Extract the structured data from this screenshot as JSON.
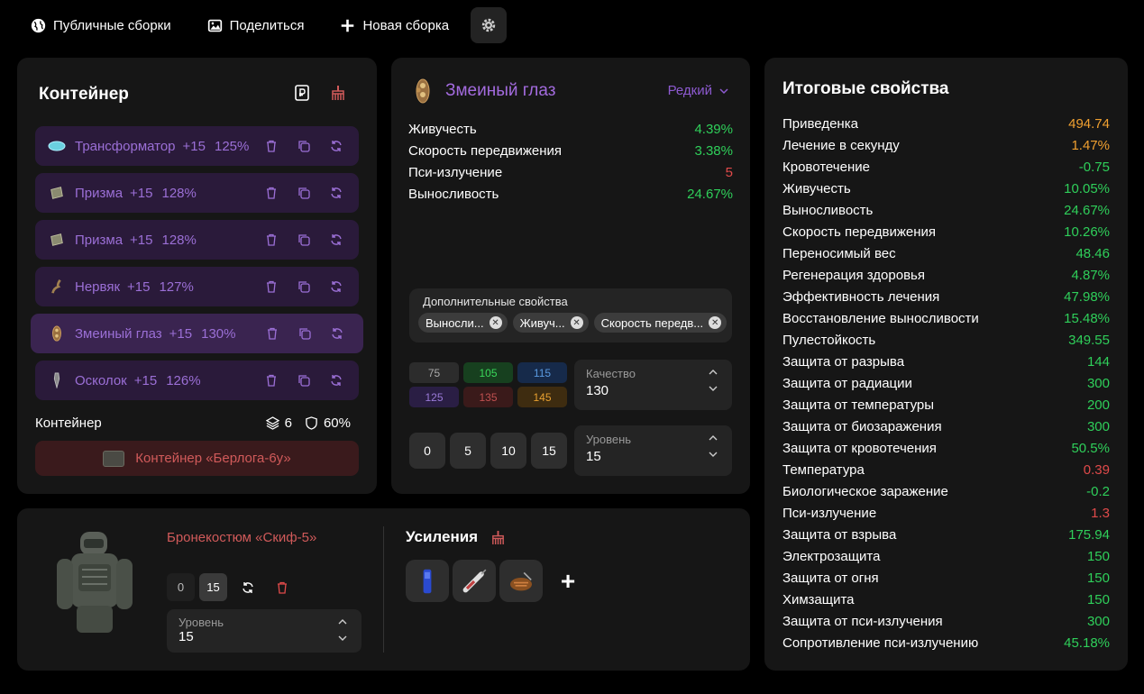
{
  "topbar": {
    "public_label": "Публичные сборки",
    "share_label": "Поделиться",
    "new_label": "Новая сборка"
  },
  "container": {
    "title": "Контейнер",
    "artifacts": [
      {
        "name": "Трансформатор",
        "level": "+15",
        "quality": "125%"
      },
      {
        "name": "Призма",
        "level": "+15",
        "quality": "128%"
      },
      {
        "name": "Призма",
        "level": "+15",
        "quality": "128%"
      },
      {
        "name": "Нервяк",
        "level": "+15",
        "quality": "127%"
      },
      {
        "name": "Змеиный глаз",
        "level": "+15",
        "quality": "130%"
      },
      {
        "name": "Осколок",
        "level": "+15",
        "quality": "126%"
      }
    ],
    "footer_label": "Контейнер",
    "slots": "6",
    "protection": "60%",
    "container_button": "Контейнер «Берлога-6у»"
  },
  "item": {
    "name": "Змеиный глаз",
    "rarity": "Редкий",
    "stats": [
      {
        "label": "Живучесть",
        "value": "4.39%"
      },
      {
        "label": "Скорость передвижения",
        "value": "3.38%"
      },
      {
        "label": "Пси-излучение",
        "value": "5"
      },
      {
        "label": "Выносливость",
        "value": "24.67%"
      }
    ],
    "extra_title": "Дополнительные свойства",
    "extra_chips": [
      "Выносли...",
      "Живуч...",
      "Скорость передв..."
    ],
    "quality_presets": [
      "75",
      "105",
      "115",
      "125",
      "135",
      "145"
    ],
    "quality_label": "Качество",
    "quality_value": "130",
    "level_presets": [
      "0",
      "5",
      "10",
      "15"
    ],
    "level_label": "Уровень",
    "level_value": "15"
  },
  "totals": {
    "title": "Итоговые свойства",
    "rows": [
      {
        "label": "Приведенка",
        "value": "494.74"
      },
      {
        "label": "Лечение в секунду",
        "value": "1.47%"
      },
      {
        "label": "Кровотечение",
        "value": "-0.75"
      },
      {
        "label": "Живучесть",
        "value": "10.05%"
      },
      {
        "label": "Выносливость",
        "value": "24.67%"
      },
      {
        "label": "Скорость передвижения",
        "value": "10.26%"
      },
      {
        "label": "Переносимый вес",
        "value": "48.46"
      },
      {
        "label": "Регенерация здоровья",
        "value": "4.87%"
      },
      {
        "label": "Эффективность лечения",
        "value": "47.98%"
      },
      {
        "label": "Восстановление выносливости",
        "value": "15.48%"
      },
      {
        "label": "Пулестойкость",
        "value": "349.55"
      },
      {
        "label": "Защита от разрыва",
        "value": "144"
      },
      {
        "label": "Защита от радиации",
        "value": "300"
      },
      {
        "label": "Защита от температуры",
        "value": "200"
      },
      {
        "label": "Защита от биозаражения",
        "value": "300"
      },
      {
        "label": "Защита от кровотечения",
        "value": "50.5%"
      },
      {
        "label": "Температура",
        "value": "0.39"
      },
      {
        "label": "Биологическое заражение",
        "value": "-0.2"
      },
      {
        "label": "Пси-излучение",
        "value": "1.3"
      },
      {
        "label": "Защита от взрыва",
        "value": "175.94"
      },
      {
        "label": "Электрозащита",
        "value": "150"
      },
      {
        "label": "Защита от огня",
        "value": "150"
      },
      {
        "label": "Химзащита",
        "value": "150"
      },
      {
        "label": "Защита от пси-излучения",
        "value": "300"
      },
      {
        "label": "Сопротивление пси-излучению",
        "value": "45.18%"
      }
    ]
  },
  "armor": {
    "name": "Бронекостюм «Скиф-5»",
    "level_min": "0",
    "level_current": "15",
    "level_label": "Уровень",
    "level_value": "15",
    "boosts_title": "Усиления"
  },
  "colors": {
    "accent_purple": "#a36bde",
    "positive": "#2fcf5a",
    "negative": "#e04a4a",
    "highlight": "#f0a030"
  }
}
